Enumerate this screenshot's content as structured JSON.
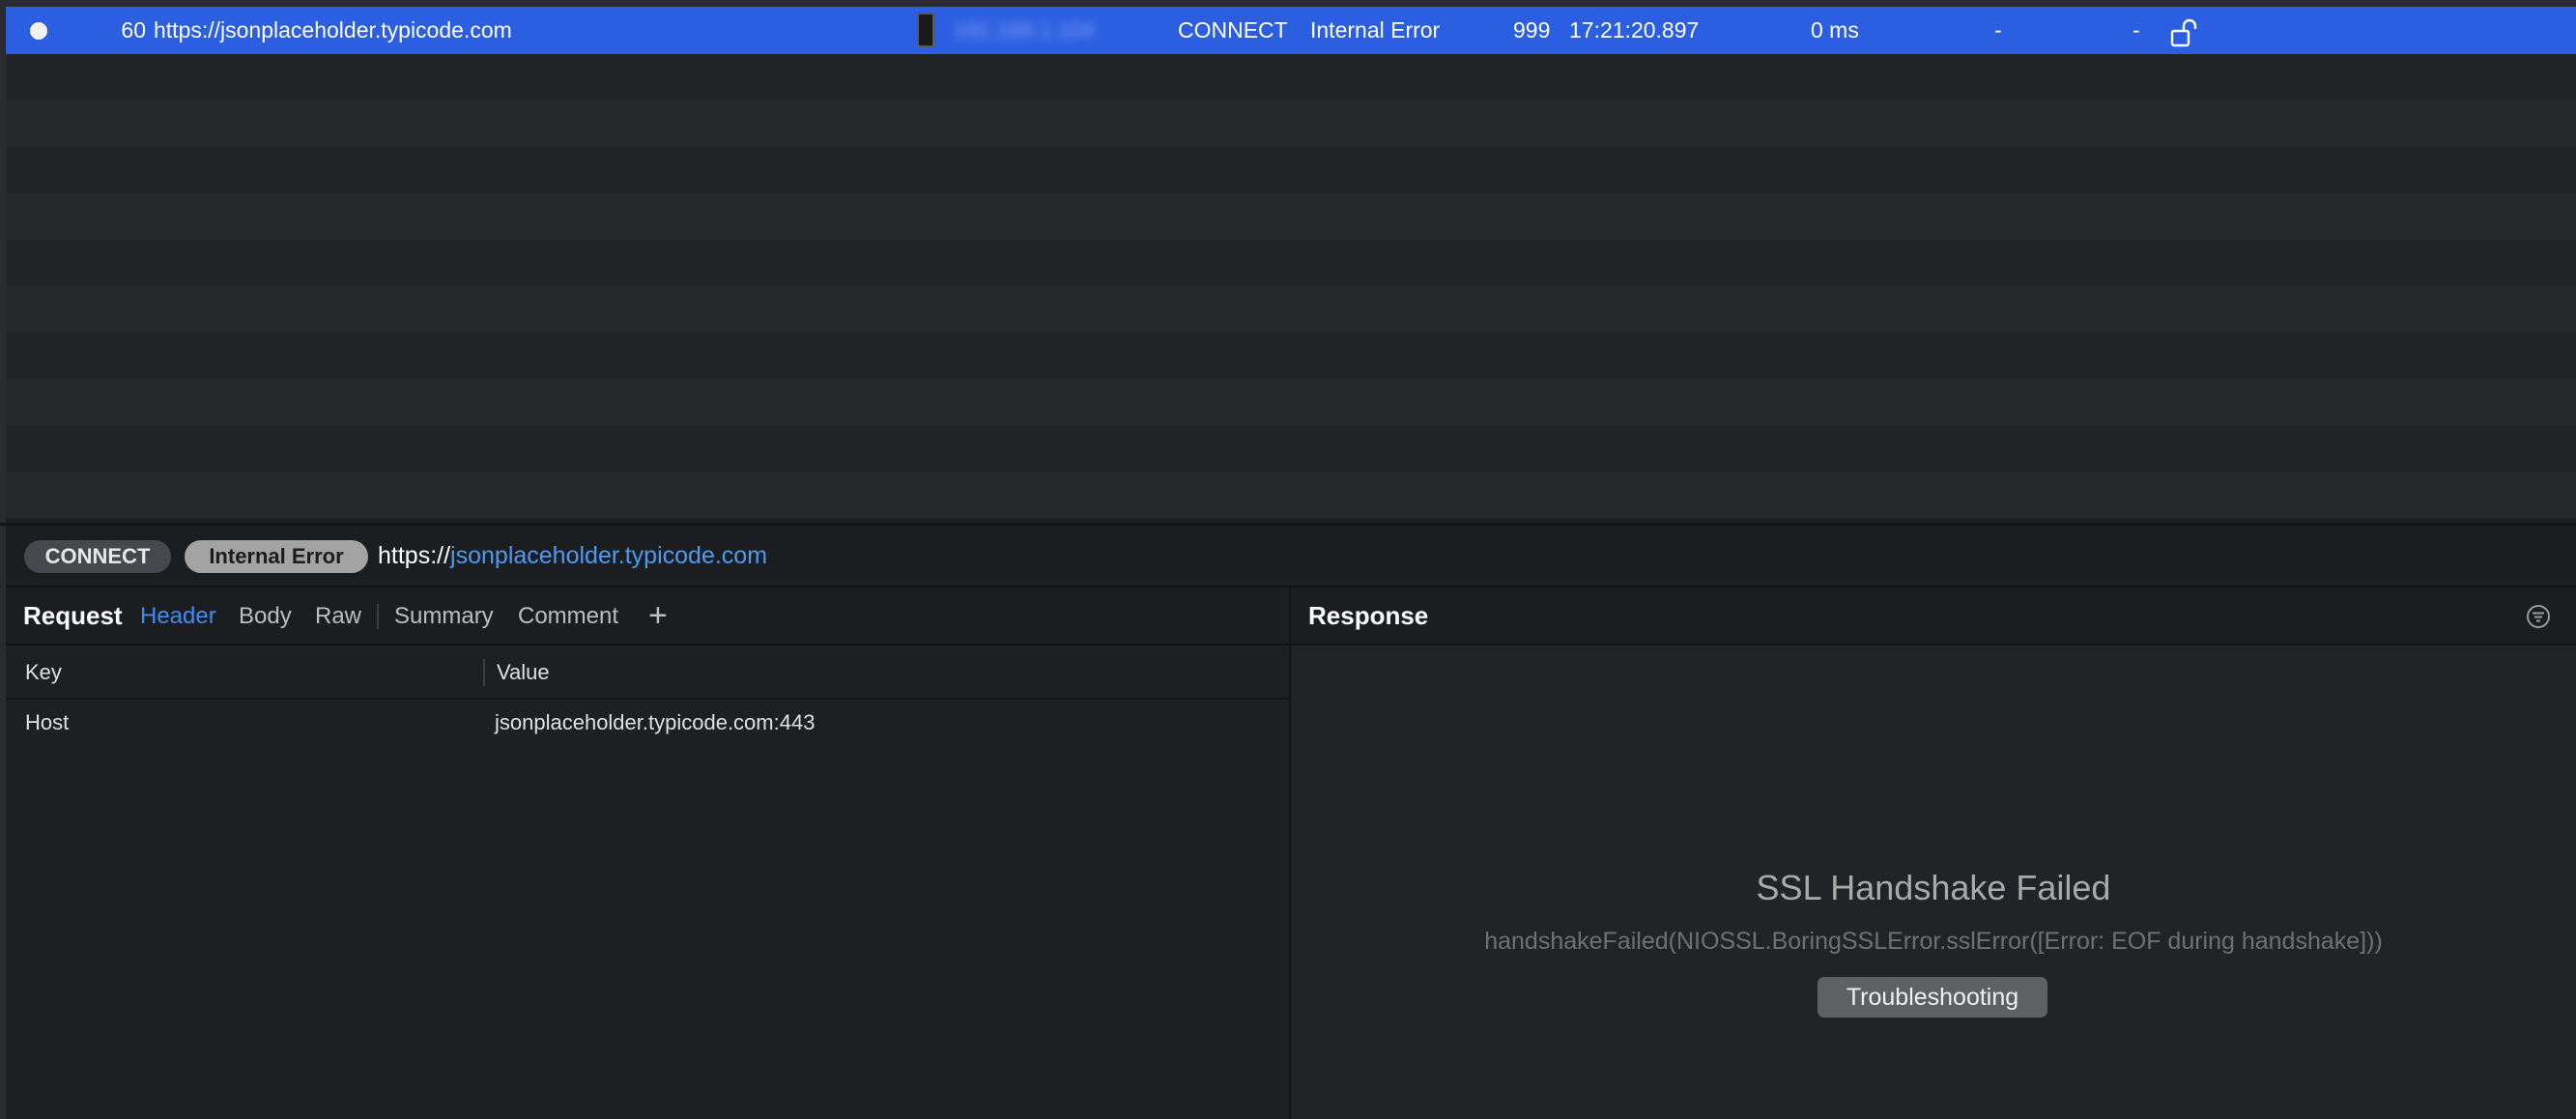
{
  "list": {
    "selected_row": {
      "id": "60",
      "url": "https://jsonplaceholder.typicode.com",
      "client_ip": "192.168.1.104",
      "method": "CONNECT",
      "status": "Internal Error",
      "code": "999",
      "time": "17:21:20.897",
      "duration": "0 ms",
      "request_size": "-",
      "response_size": "-",
      "lock_icon": "unlocked-padlock-icon"
    },
    "empty_rows": 10
  },
  "detail": {
    "method": "CONNECT",
    "status": "Internal Error",
    "url_scheme": "https://",
    "url_host": "jsonplaceholder.typicode.com"
  },
  "request": {
    "title": "Request",
    "tabs": {
      "header": "Header",
      "body": "Body",
      "raw": "Raw",
      "summary": "Summary",
      "comment": "Comment",
      "add": "+"
    },
    "active_tab": "Header",
    "columns": {
      "key": "Key",
      "value": "Value"
    },
    "rows": [
      {
        "key": "Host",
        "value": "jsonplaceholder.typicode.com:443"
      }
    ]
  },
  "response": {
    "title": "Response",
    "error_title": "SSL Handshake Failed",
    "error_message": "handshakeFailed(NIOSSL.BoringSSLError.sslError([Error:  EOF during handshake]))",
    "troubleshoot_label": "Troubleshooting"
  },
  "colors": {
    "selected_row": "#2b5ee0",
    "link": "#4c9bf2",
    "active_tab": "#3f8cf3"
  }
}
